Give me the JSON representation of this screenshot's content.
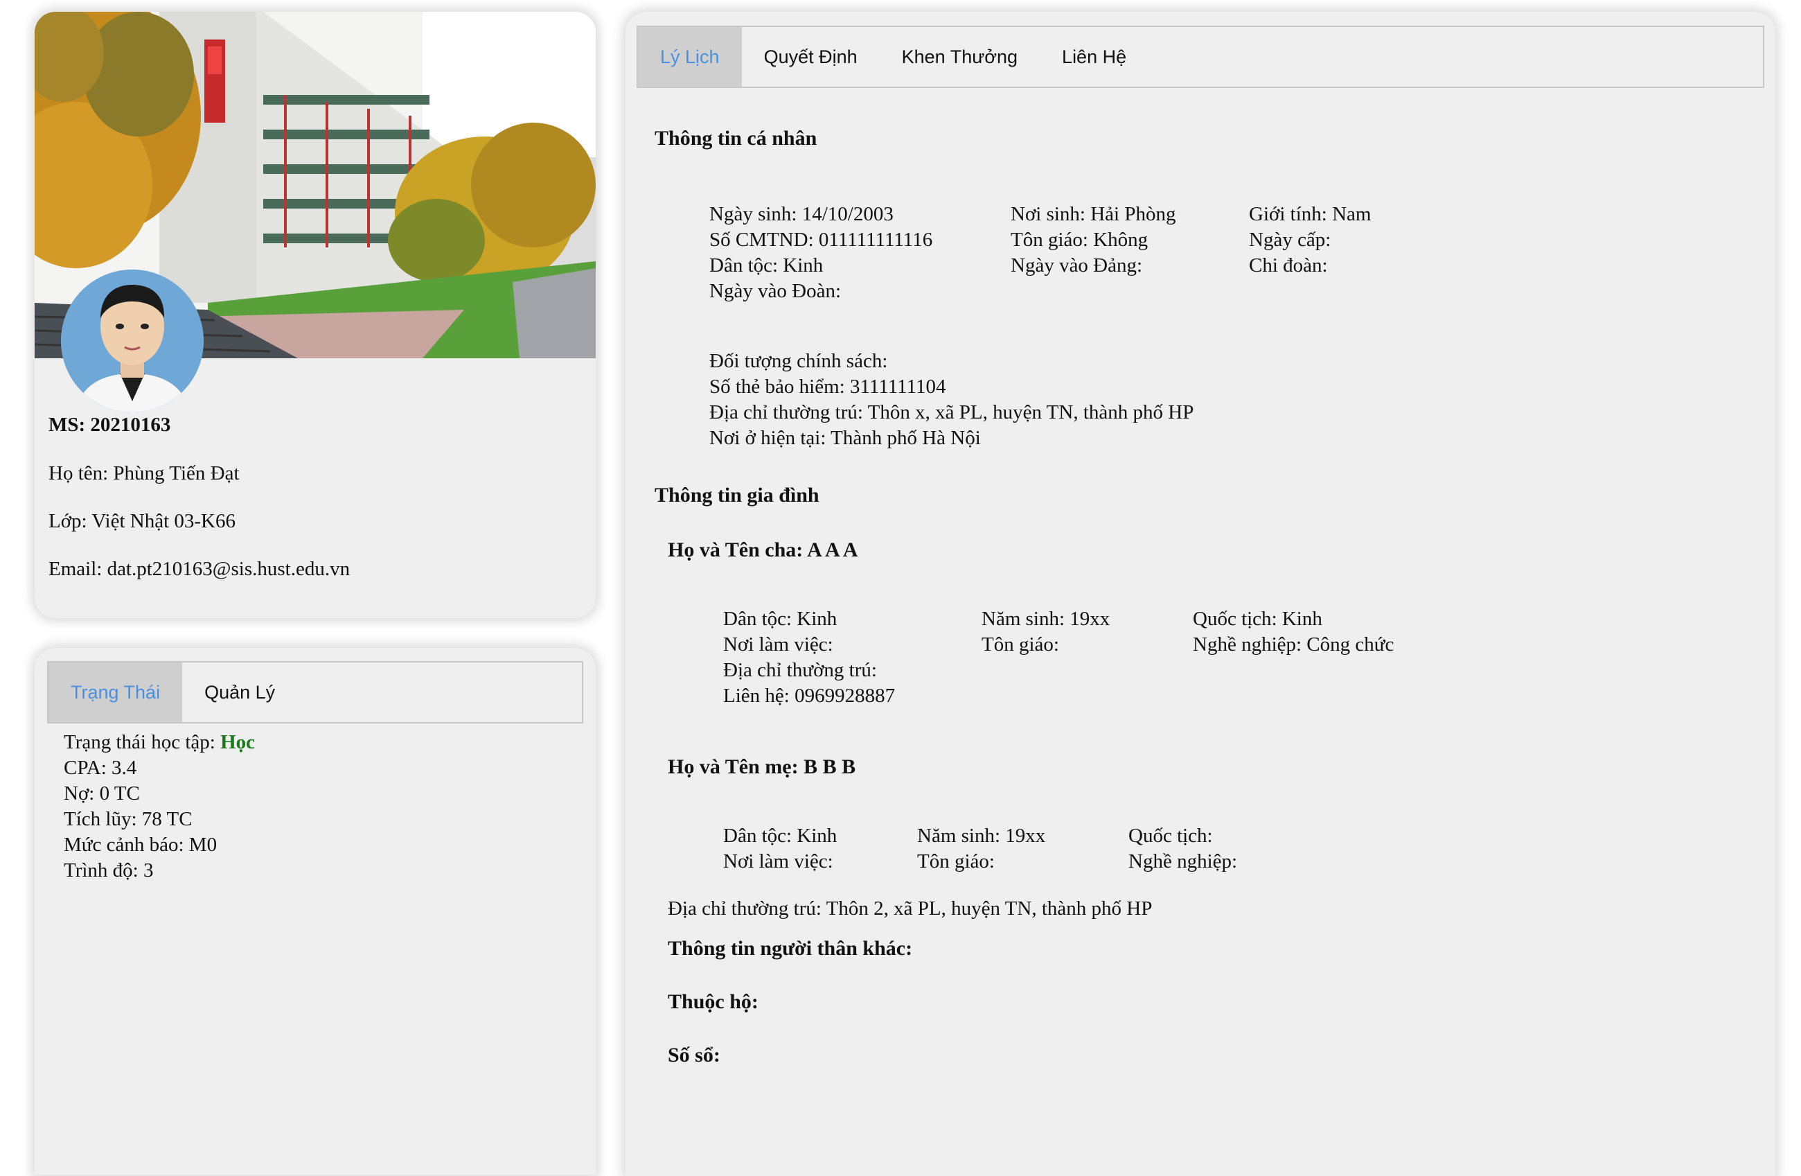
{
  "profile": {
    "ms": "MS: 20210163",
    "name": "Họ tên: Phùng Tiến Đạt",
    "class": "Lớp: Việt Nhật 03-K66",
    "email": "Email: dat.pt210163@sis.hust.edu.vn"
  },
  "status": {
    "tabs": [
      "Trạng Thái",
      "Quản Lý"
    ],
    "study_label": "Trạng thái học tập: ",
    "study_value": "Học",
    "cpa": "CPA: 3.4",
    "debt": "Nợ: 0 TC",
    "accumulated": "Tích lũy: 78 TC",
    "warning": "Mức cảnh báo: M0",
    "level": "Trình độ: 3"
  },
  "detail": {
    "tabs": [
      "Lý Lịch",
      "Quyết Định",
      "Khen Thưởng",
      "Liên Hệ"
    ],
    "personal_heading": "Thông tin cá nhân",
    "personal": {
      "dob": "Ngày sinh: 14/10/2003",
      "birthplace": "Nơi sinh: Hải Phòng",
      "gender": "Giới tính: Nam",
      "id_card": "Số CMTND: 011111111116",
      "religion": "Tôn giáo: Không",
      "issue_date": "Ngày cấp:",
      "ethnicity": "Dân tộc: Kinh",
      "party_date": "Ngày vào Đảng:",
      "union_branch": "Chi đoàn:",
      "youth_date": "Ngày vào Đoàn:",
      "policy": "Đối tượng chính sách:",
      "insurance": "Số thẻ bảo hiểm: 3111111104",
      "permanent_address": "Địa chỉ thường trú: Thôn x, xã PL, huyện TN, thành phố HP",
      "current_address": "Nơi ở hiện tại: Thành phố Hà Nội"
    },
    "family_heading": "Thông tin gia đình",
    "father": {
      "heading": "Họ và Tên cha: A A A",
      "ethnicity": "Dân tộc: Kinh",
      "birth_year": "Năm sinh: 19xx",
      "nationality": "Quốc tịch: Kinh",
      "workplace": "Nơi làm việc:",
      "religion": "Tôn giáo:",
      "occupation": "Nghề nghiệp: Công chức",
      "address": "Địa chỉ thường trú:",
      "contact": "Liên hệ: 0969928887"
    },
    "mother": {
      "heading": "Họ và Tên mẹ: B B B",
      "ethnicity": "Dân tộc: Kinh",
      "birth_year": "Năm sinh: 19xx",
      "nationality": "Quốc tịch:",
      "workplace": "Nơi làm việc:",
      "religion": "Tôn giáo:",
      "occupation": "Nghề nghiệp:"
    },
    "family_address": "Địa chỉ thường trú: Thôn 2, xã PL, huyện TN, thành phố HP",
    "relatives": "Thông tin người thân khác:",
    "household": "Thuộc hộ:",
    "book_no": "Số sổ:"
  }
}
